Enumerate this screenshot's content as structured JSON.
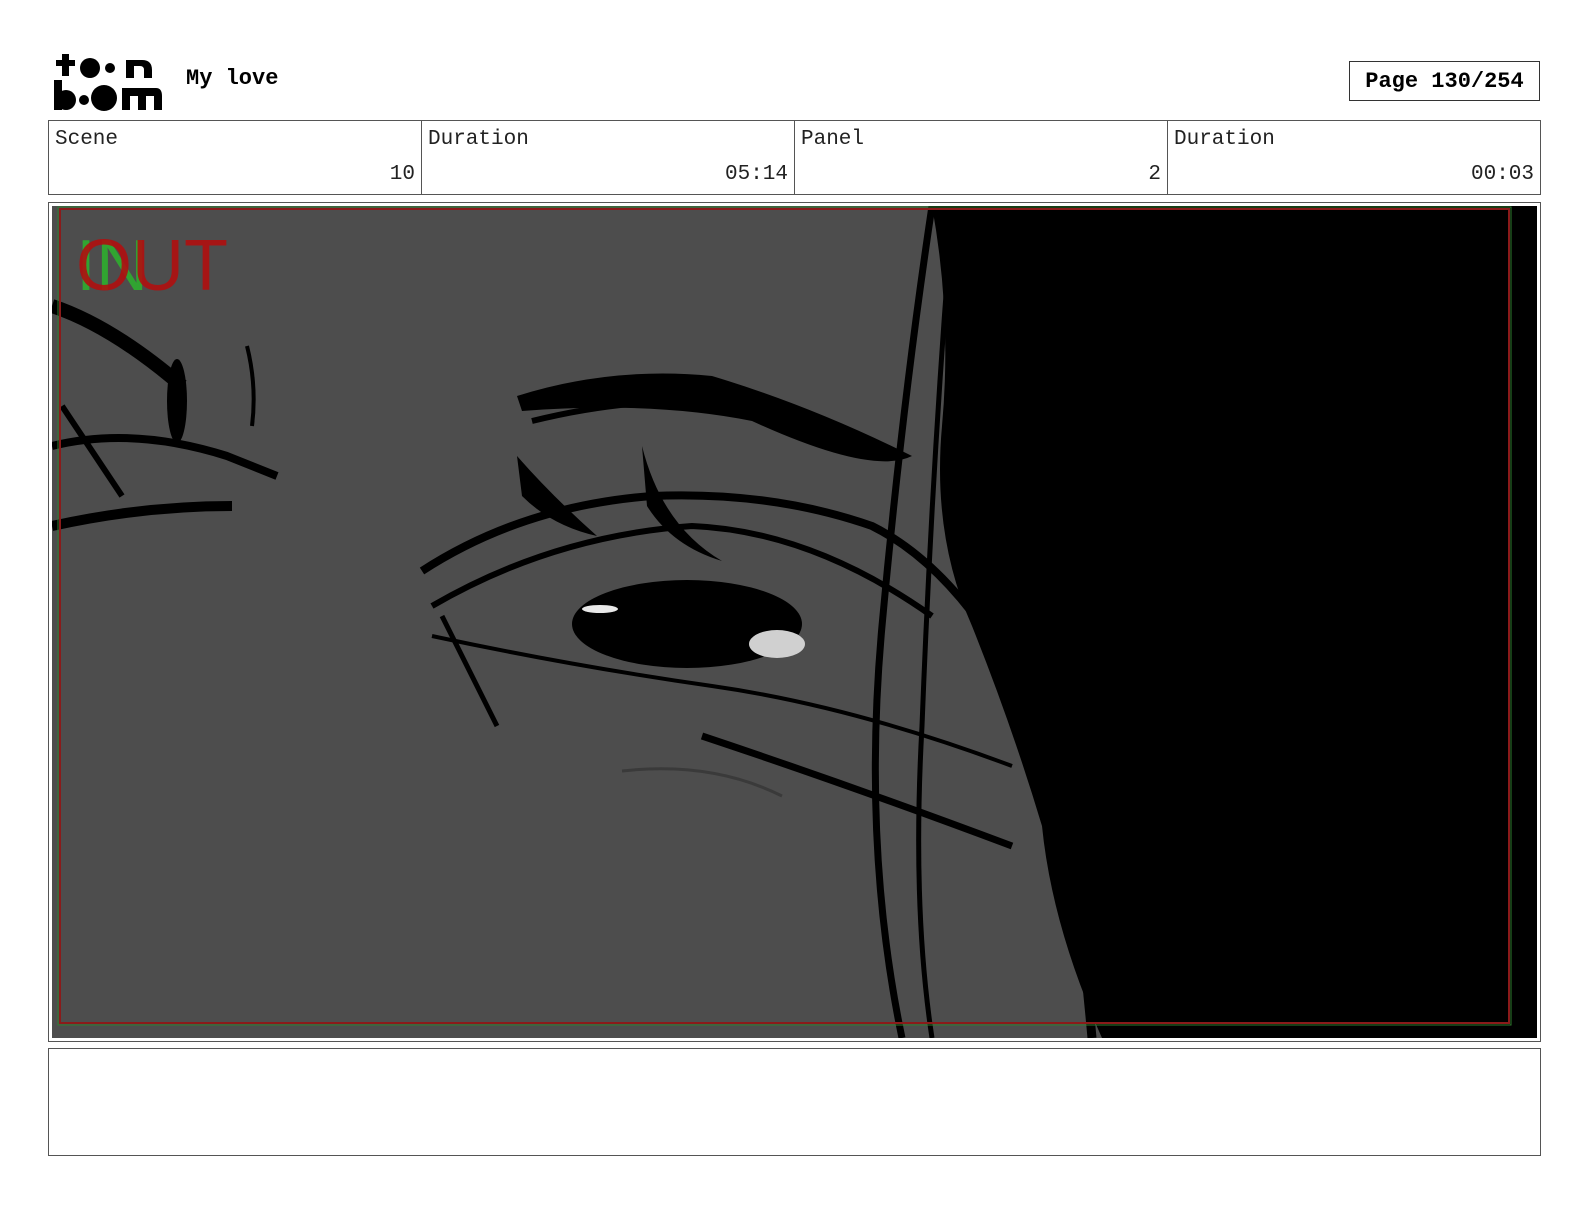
{
  "header": {
    "logo_text_top": "toon",
    "logo_text_bottom": "boom",
    "project_title": "My love",
    "page_label": "Page 130/254"
  },
  "info": {
    "scene_label": "Scene",
    "scene_value": "10",
    "scene_duration_label": "Duration",
    "scene_duration_value": "05:14",
    "panel_label": "Panel",
    "panel_value": "2",
    "panel_duration_label": "Duration",
    "panel_duration_value": "00:03"
  },
  "panel": {
    "in_marker": "IN",
    "out_marker": "OUT",
    "background_color": "#4d4d4d",
    "ink_color": "#000000",
    "safe_frame_color": "#8b1a1a",
    "in_color": "#2fae2f",
    "out_color": "#b01010"
  },
  "caption": {
    "text": ""
  }
}
